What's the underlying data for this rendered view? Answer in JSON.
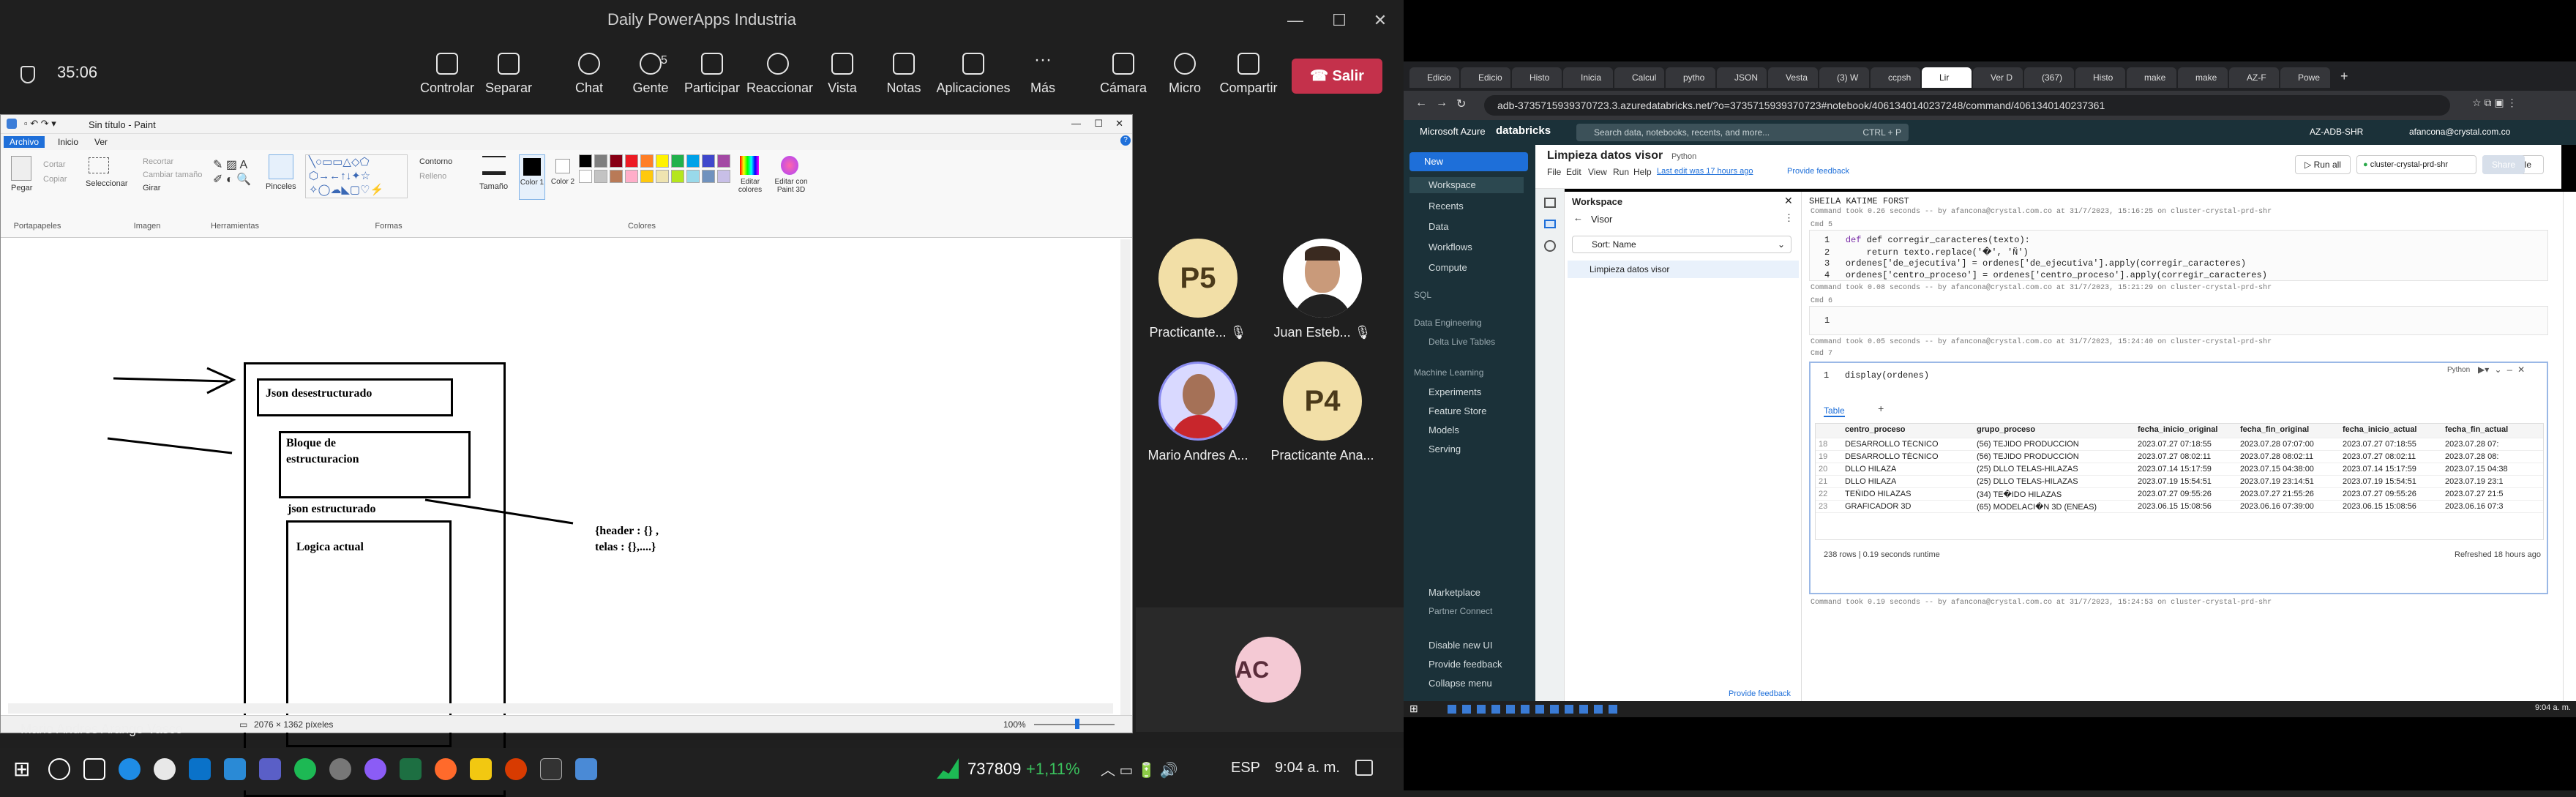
{
  "teams": {
    "meeting_title": "Daily PowerApps Industria",
    "timer": "35:06",
    "toolbar": [
      {
        "label": "Controlar",
        "icon": "control-icon"
      },
      {
        "label": "Separar",
        "icon": "popout-icon"
      },
      {
        "label": "Chat",
        "icon": "chat-icon"
      },
      {
        "label": "Gente",
        "icon": "people-icon",
        "count": "5"
      },
      {
        "label": "Participar",
        "icon": "raise-hand-icon"
      },
      {
        "label": "Reaccionar",
        "icon": "react-icon"
      },
      {
        "label": "Vista",
        "icon": "view-icon"
      },
      {
        "label": "Notas",
        "icon": "notes-icon"
      },
      {
        "label": "Aplicaciones",
        "icon": "apps-icon"
      },
      {
        "label": "Más",
        "icon": "more-icon"
      },
      {
        "label": "Cámara",
        "icon": "camera-off-icon"
      },
      {
        "label": "Micro",
        "icon": "mic-off-icon"
      },
      {
        "label": "Compartir",
        "icon": "share-icon"
      }
    ],
    "leave_label": "Salir",
    "participants": [
      {
        "name": "Practicante...",
        "initials": "P5",
        "color": "#f2dfa7"
      },
      {
        "name": "Juan Esteb...",
        "initials": "",
        "color": "#ffffff"
      },
      {
        "name": "Mario Andres A...",
        "initials": "",
        "color": "#d9d9ff"
      },
      {
        "name": "Practicante Ana...",
        "initials": "P4",
        "color": "#f2dfa7"
      },
      {
        "name": "",
        "initials": "AC",
        "color": "#f4c9d4"
      }
    ],
    "presenter_name": "Mario Andres Arango Vasco"
  },
  "paint": {
    "window_title": "Sin título - Paint",
    "tabs": [
      "Archivo",
      "Inicio",
      "Ver"
    ],
    "groups": [
      "Portapapeles",
      "Imagen",
      "Herramientas",
      "Formas",
      "Colores"
    ],
    "buttons": [
      "Pegar",
      "Cortar",
      "Copiar",
      "Seleccionar",
      "Recortar",
      "Cambiar tamaño",
      "Girar",
      "Pinceles",
      "Contorno",
      "Relleno",
      "Tamaño",
      "Color 1",
      "Color 2",
      "Editar colores",
      "Editar con Paint 3D"
    ],
    "colors": [
      "#000000",
      "#7f7f7f",
      "#880015",
      "#ed1c24",
      "#ff7f27",
      "#fff200",
      "#22b14c",
      "#00a2e8",
      "#3f48cc",
      "#a349a4",
      "#ffffff",
      "#c3c3c3",
      "#b97a57",
      "#ffaec9",
      "#ffc90e",
      "#efe4b0",
      "#b5e61d",
      "#99d9ea",
      "#7092be",
      "#c8bfe7"
    ],
    "status_size": "2076 × 1362 píxeles",
    "zoom": "100%",
    "drawing": {
      "box1": "Json desestructurado",
      "box2_line1": "Bloque de",
      "box2_line2": "estructuracion",
      "label3": "json estructurado",
      "box4": "Logica actual",
      "note_line1": "{header : {} ,",
      "note_line2": "telas : {},....}"
    }
  },
  "taskbar_left": {
    "stock": "737809",
    "stock_change": "+1,11%",
    "lang": "ESP",
    "clock": "9:04 a. m."
  },
  "chrome": {
    "tabs": [
      "Edicio",
      "Edicio",
      "Histo",
      "Inicia",
      "Calcul",
      "pytho",
      "JSON",
      "Vesta",
      "(3) W",
      "ccpsh",
      "Lir",
      "Ver D",
      "(367)",
      "Histo",
      "make",
      "make",
      "AZ-F",
      "Powe"
    ],
    "active_tab": 10,
    "url": "adb-3735715939370723.3.azuredatabricks.net/?o=3735715939370723#notebook/4061340140237248/command/4061340140237361"
  },
  "databricks": {
    "brand_ms": "Microsoft Azure",
    "brand": "databricks",
    "search_placeholder": "Search data, notebooks, recents, and more...",
    "search_shortcut": "CTRL + P",
    "workspace_id": "AZ-ADB-SHR",
    "user": "afancona@crystal.com.co",
    "new_label": "New",
    "sidebar": [
      "Workspace",
      "Recents",
      "Data",
      "Workflows",
      "Compute"
    ],
    "sidebar_sql": "SQL",
    "sidebar_de": "Data Engineering",
    "sidebar_dlt": "Delta Live Tables",
    "sidebar_ml": "Machine Learning",
    "sidebar_ml_items": [
      "Experiments",
      "Feature Store",
      "Models",
      "Serving"
    ],
    "sidebar_bottom": [
      "Marketplace",
      "Partner Connect",
      "Disable new UI",
      "Provide feedback",
      "Collapse menu"
    ],
    "notebook_title": "Limpieza datos visor",
    "language": "Python",
    "menu": [
      "File",
      "Edit",
      "View",
      "Run",
      "Help"
    ],
    "last_edit": "Last edit was 17 hours ago",
    "feedback": "Provide feedback",
    "run_all": "Run all",
    "cluster": "cluster-crystal-prd-shr",
    "schedule": "Schedule",
    "share": "Share",
    "panel_title": "Workspace",
    "panel_folder": "Visor",
    "sort": "Sort: Name",
    "panel_item": "Limpieza datos visor",
    "bottom_feedback": "Provide feedback",
    "cell4_out": "SHEILA KATIME FORST",
    "cmd1": "Command took 0.26 seconds -- by afancona@crystal.com.co at 31/7/2023, 15:16:25 on cluster-crystal-prd-shr",
    "cell5_label": "Cmd 5",
    "code5": [
      "def corregir_caracteres(texto):",
      "    return texto.replace('�', 'Ñ')",
      "ordenes['de_ejecutiva'] = ordenes['de_ejecutiva'].apply(corregir_caracteres)",
      "ordenes['centro_proceso'] = ordenes['centro_proceso'].apply(corregir_caracteres)"
    ],
    "cmd2": "Command took 0.08 seconds -- by afancona@crystal.com.co at 31/7/2023, 15:21:29 on cluster-crystal-prd-shr",
    "cell6_label": "Cmd 6",
    "cmd3": "Command took 0.05 seconds -- by afancona@crystal.com.co at 31/7/2023, 15:24:40 on cluster-crystal-prd-shr",
    "cell7_label": "Cmd 7",
    "code7": "display(ordenes)",
    "cell7_lang": "Python",
    "table_tab": "Table",
    "columns": [
      "centro_proceso",
      "grupo_proceso",
      "fecha_inicio_original",
      "fecha_fin_original",
      "fecha_inicio_actual",
      "fecha_fin_actual"
    ],
    "rows": [
      [
        "18",
        "DESARROLLO TÉCNICO",
        "(56) TEJIDO PRODUCCIÓN",
        "2023.07.27 07:18:55",
        "2023.07.28 07:07:00",
        "2023.07.27 07:18:55",
        "2023.07.28 07:"
      ],
      [
        "19",
        "DESARROLLO TÉCNICO",
        "(56) TEJIDO PRODUCCIÓN",
        "2023.07.27 08:02:11",
        "2023.07.28 08:02:11",
        "2023.07.27 08:02:11",
        "2023.07.28 08:"
      ],
      [
        "20",
        "DLLO HILAZA",
        "(25) DLLO TELAS-HILAZAS",
        "2023.07.14 15:17:59",
        "2023.07.15 04:38:00",
        "2023.07.14 15:17:59",
        "2023.07.15 04:38"
      ],
      [
        "21",
        "DLLO HILAZA",
        "(25) DLLO TELAS-HILAZAS",
        "2023.07.19 15:54:51",
        "2023.07.19 23:14:51",
        "2023.07.19 15:54:51",
        "2023.07.19 23:1"
      ],
      [
        "22",
        "TEÑIDO HILAZAS",
        "(34) TE�IDO HILAZAS",
        "2023.07.27 09:55:26",
        "2023.07.27 21:55:26",
        "2023.07.27 09:55:26",
        "2023.07.27 21:5"
      ],
      [
        "23",
        "GRAFICADOR 3D",
        "(65) MODELACI�N 3D (ENEAS)",
        "2023.06.15 15:08:56",
        "2023.06.16 07:39:00",
        "2023.06.15 15:08:56",
        "2023.06.16 07:3"
      ]
    ],
    "row_count": "238 rows  |  0.19 seconds runtime",
    "refreshed": "Refreshed 18 hours ago",
    "cmd4": "Command took 0.19 seconds -- by afancona@crystal.com.co at 31/7/2023, 15:24:53 on cluster-crystal-prd-shr",
    "clock_right": "9:04 a. m."
  }
}
